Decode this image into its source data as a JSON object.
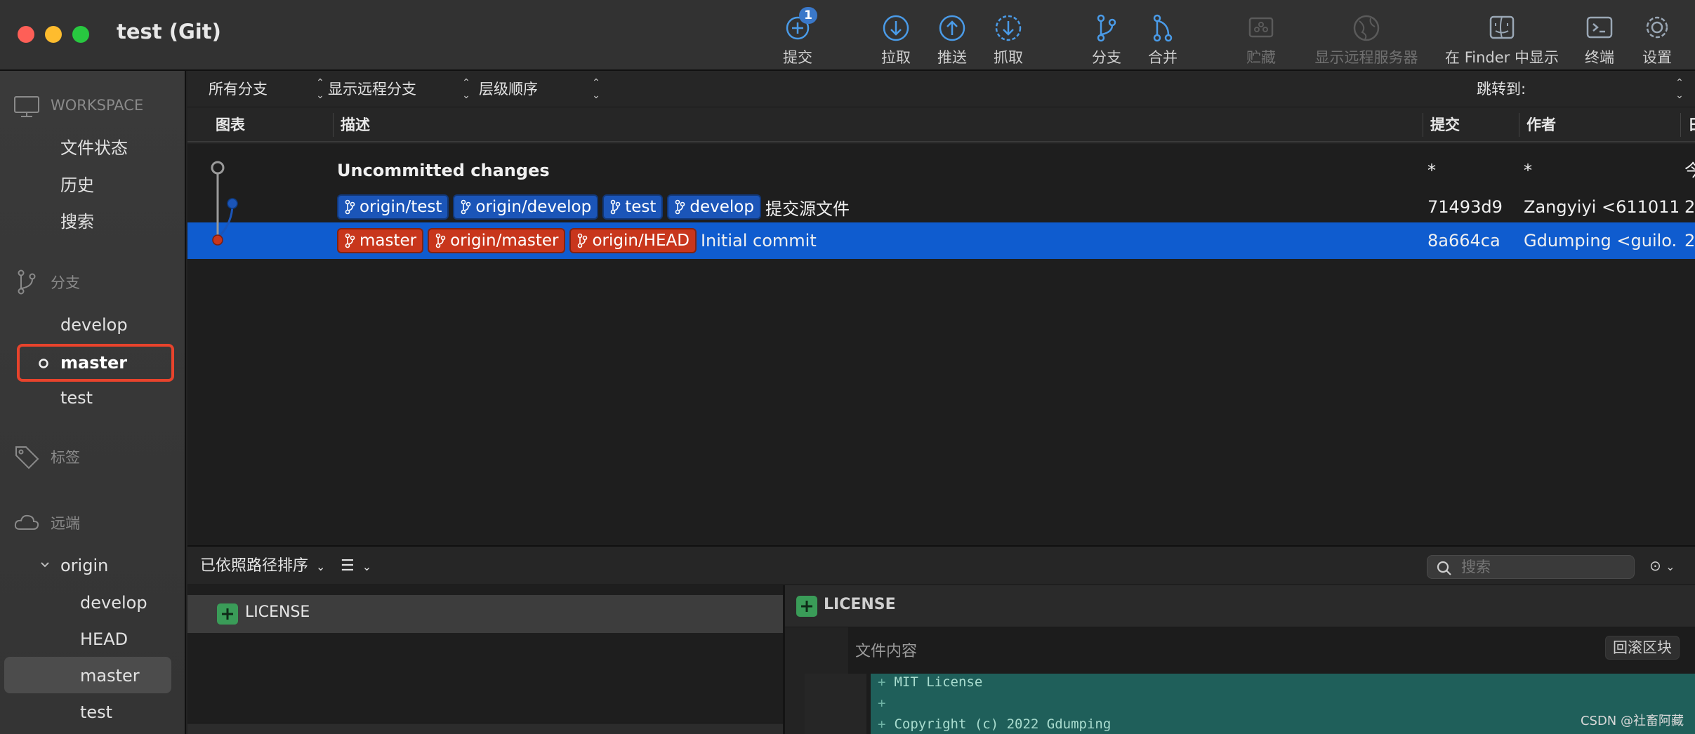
{
  "window": {
    "title": "test (Git)"
  },
  "toolbar": {
    "commit": {
      "label": "提交",
      "badge": "1"
    },
    "pull": {
      "label": "拉取"
    },
    "push": {
      "label": "推送"
    },
    "fetch": {
      "label": "抓取"
    },
    "branch": {
      "label": "分支"
    },
    "merge": {
      "label": "合并"
    },
    "stash": {
      "label": "贮藏"
    },
    "show_remote": {
      "label": "显示远程服务器"
    },
    "show_in_finder": {
      "label": "在 Finder 中显示"
    },
    "terminal": {
      "label": "终端"
    },
    "settings": {
      "label": "设置"
    }
  },
  "sidebar": {
    "workspace": {
      "title": "WORKSPACE",
      "items": [
        "文件状态",
        "历史",
        "搜索"
      ]
    },
    "branches": {
      "title": "分支",
      "items": [
        "develop",
        "master",
        "test"
      ],
      "current": "master"
    },
    "tags": {
      "title": "标签"
    },
    "remotes": {
      "title": "远端",
      "origin": {
        "label": "origin",
        "items": [
          "develop",
          "HEAD",
          "master",
          "test"
        ]
      }
    }
  },
  "filters": {
    "branches": "所有分支",
    "remote_branches": "显示远程分支",
    "order": "层级顺序",
    "jump_to": "跳转到:"
  },
  "columns": {
    "graph": "图表",
    "description": "描述",
    "commit": "提交",
    "author": "作者",
    "date": "日"
  },
  "commits": [
    {
      "description": "Uncommitted changes",
      "refs": [],
      "hash": "*",
      "author": "*",
      "date": "今"
    },
    {
      "description": "提交源文件",
      "refs": [
        "origin/test",
        "origin/develop",
        "test",
        "develop"
      ],
      "ref_color": "#1b55b8",
      "hash": "71493d9",
      "author": "Zangyiyi <611011...",
      "date": "2"
    },
    {
      "description": "Initial commit",
      "refs": [
        "master",
        "origin/master",
        "origin/HEAD"
      ],
      "ref_color": "#c8361c",
      "hash": "8a664ca",
      "author": "Gdumping <guilo...",
      "date": "2",
      "selected": true
    }
  ],
  "bottom_toolbar": {
    "sort": "已依照路径排序",
    "search_placeholder": "搜索"
  },
  "files": [
    {
      "name": "LICENSE",
      "status": "added"
    }
  ],
  "diff": {
    "file": "LICENSE",
    "hunk_title": "文件内容",
    "revert_hunk": "回滚区块",
    "lines": [
      {
        "prefix": "+",
        "text": "MIT License"
      },
      {
        "prefix": "+",
        "text": ""
      },
      {
        "prefix": "+",
        "text": "Copyright (c) 2022 Gdumping"
      }
    ]
  },
  "watermark": "CSDN @社畜阿藏",
  "colors": {
    "selection": "#0f5ccf",
    "local_ref": "#1b55b8",
    "head_ref": "#c8361c",
    "sidebar_highlight_border": "#e8432c",
    "added": "#3a9c58",
    "diff_added_bg": "#1f5f5a"
  }
}
